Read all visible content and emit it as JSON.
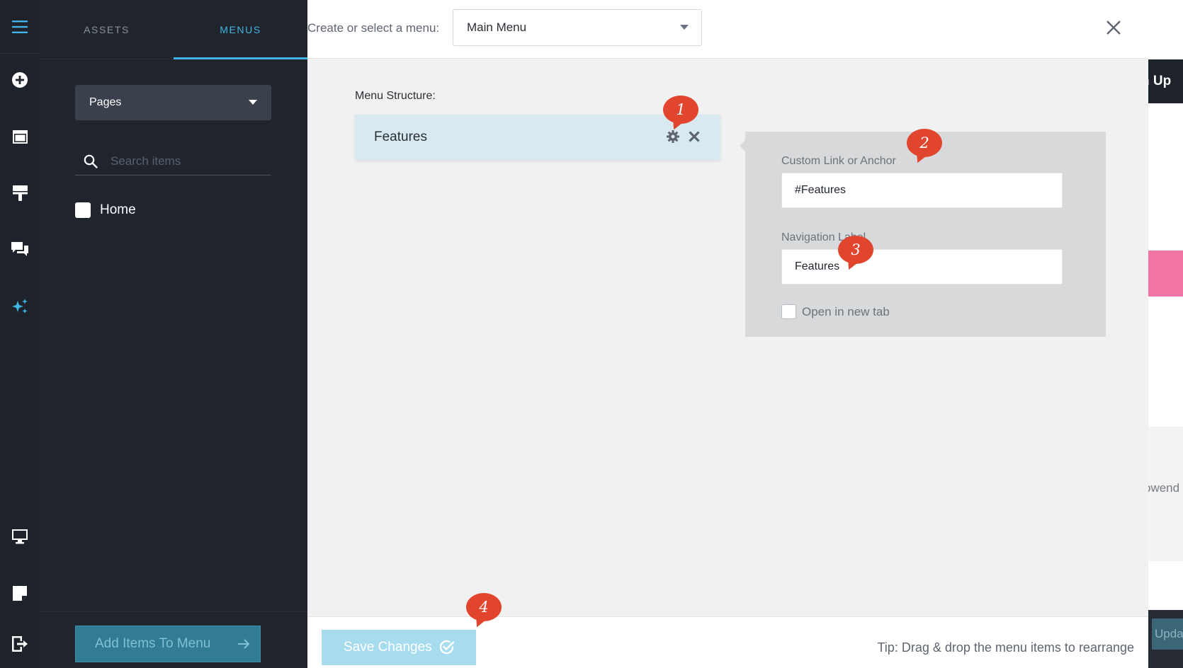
{
  "colors": {
    "accent": "#3fb6e6",
    "rail_bg": "#1d222b",
    "panel_bg": "#1f242d",
    "annotation": "#e2452d"
  },
  "rail": {
    "icons": [
      "hamburger-icon",
      "add-circle-icon",
      "window-icon",
      "paint-roller-icon",
      "chat-icon",
      "sparkles-icon",
      "monitor-icon",
      "sticky-note-icon",
      "exit-icon"
    ]
  },
  "left_panel": {
    "tabs": [
      {
        "label": "ASSETS",
        "active": false
      },
      {
        "label": "MENUS",
        "active": true
      }
    ],
    "source_dropdown": {
      "value": "Pages"
    },
    "search": {
      "placeholder": "Search items",
      "value": ""
    },
    "items": [
      {
        "label": "Home",
        "checked": false
      }
    ],
    "add_button": {
      "label": "Add Items To Menu"
    }
  },
  "topbar": {
    "label": "Create or select a menu:",
    "menu_select": {
      "value": "Main Menu"
    }
  },
  "structure": {
    "label": "Menu Structure:",
    "items": [
      {
        "label": "Features"
      }
    ]
  },
  "settings": {
    "link_label": "Custom Link or Anchor",
    "link_value": "#Features",
    "nav_label": "Navigation Label",
    "nav_value": "Features",
    "new_tab_label": "Open in new tab",
    "new_tab_checked": false
  },
  "bottombar": {
    "save_label": "Save Changes",
    "tip": "Tip: Drag & drop the menu items to rearrange"
  },
  "background_page": {
    "signup_fragment": "n Up",
    "text_fragment": "owend",
    "button_fragment": "Upda"
  },
  "annotations": [
    "1",
    "2",
    "3",
    "4"
  ]
}
